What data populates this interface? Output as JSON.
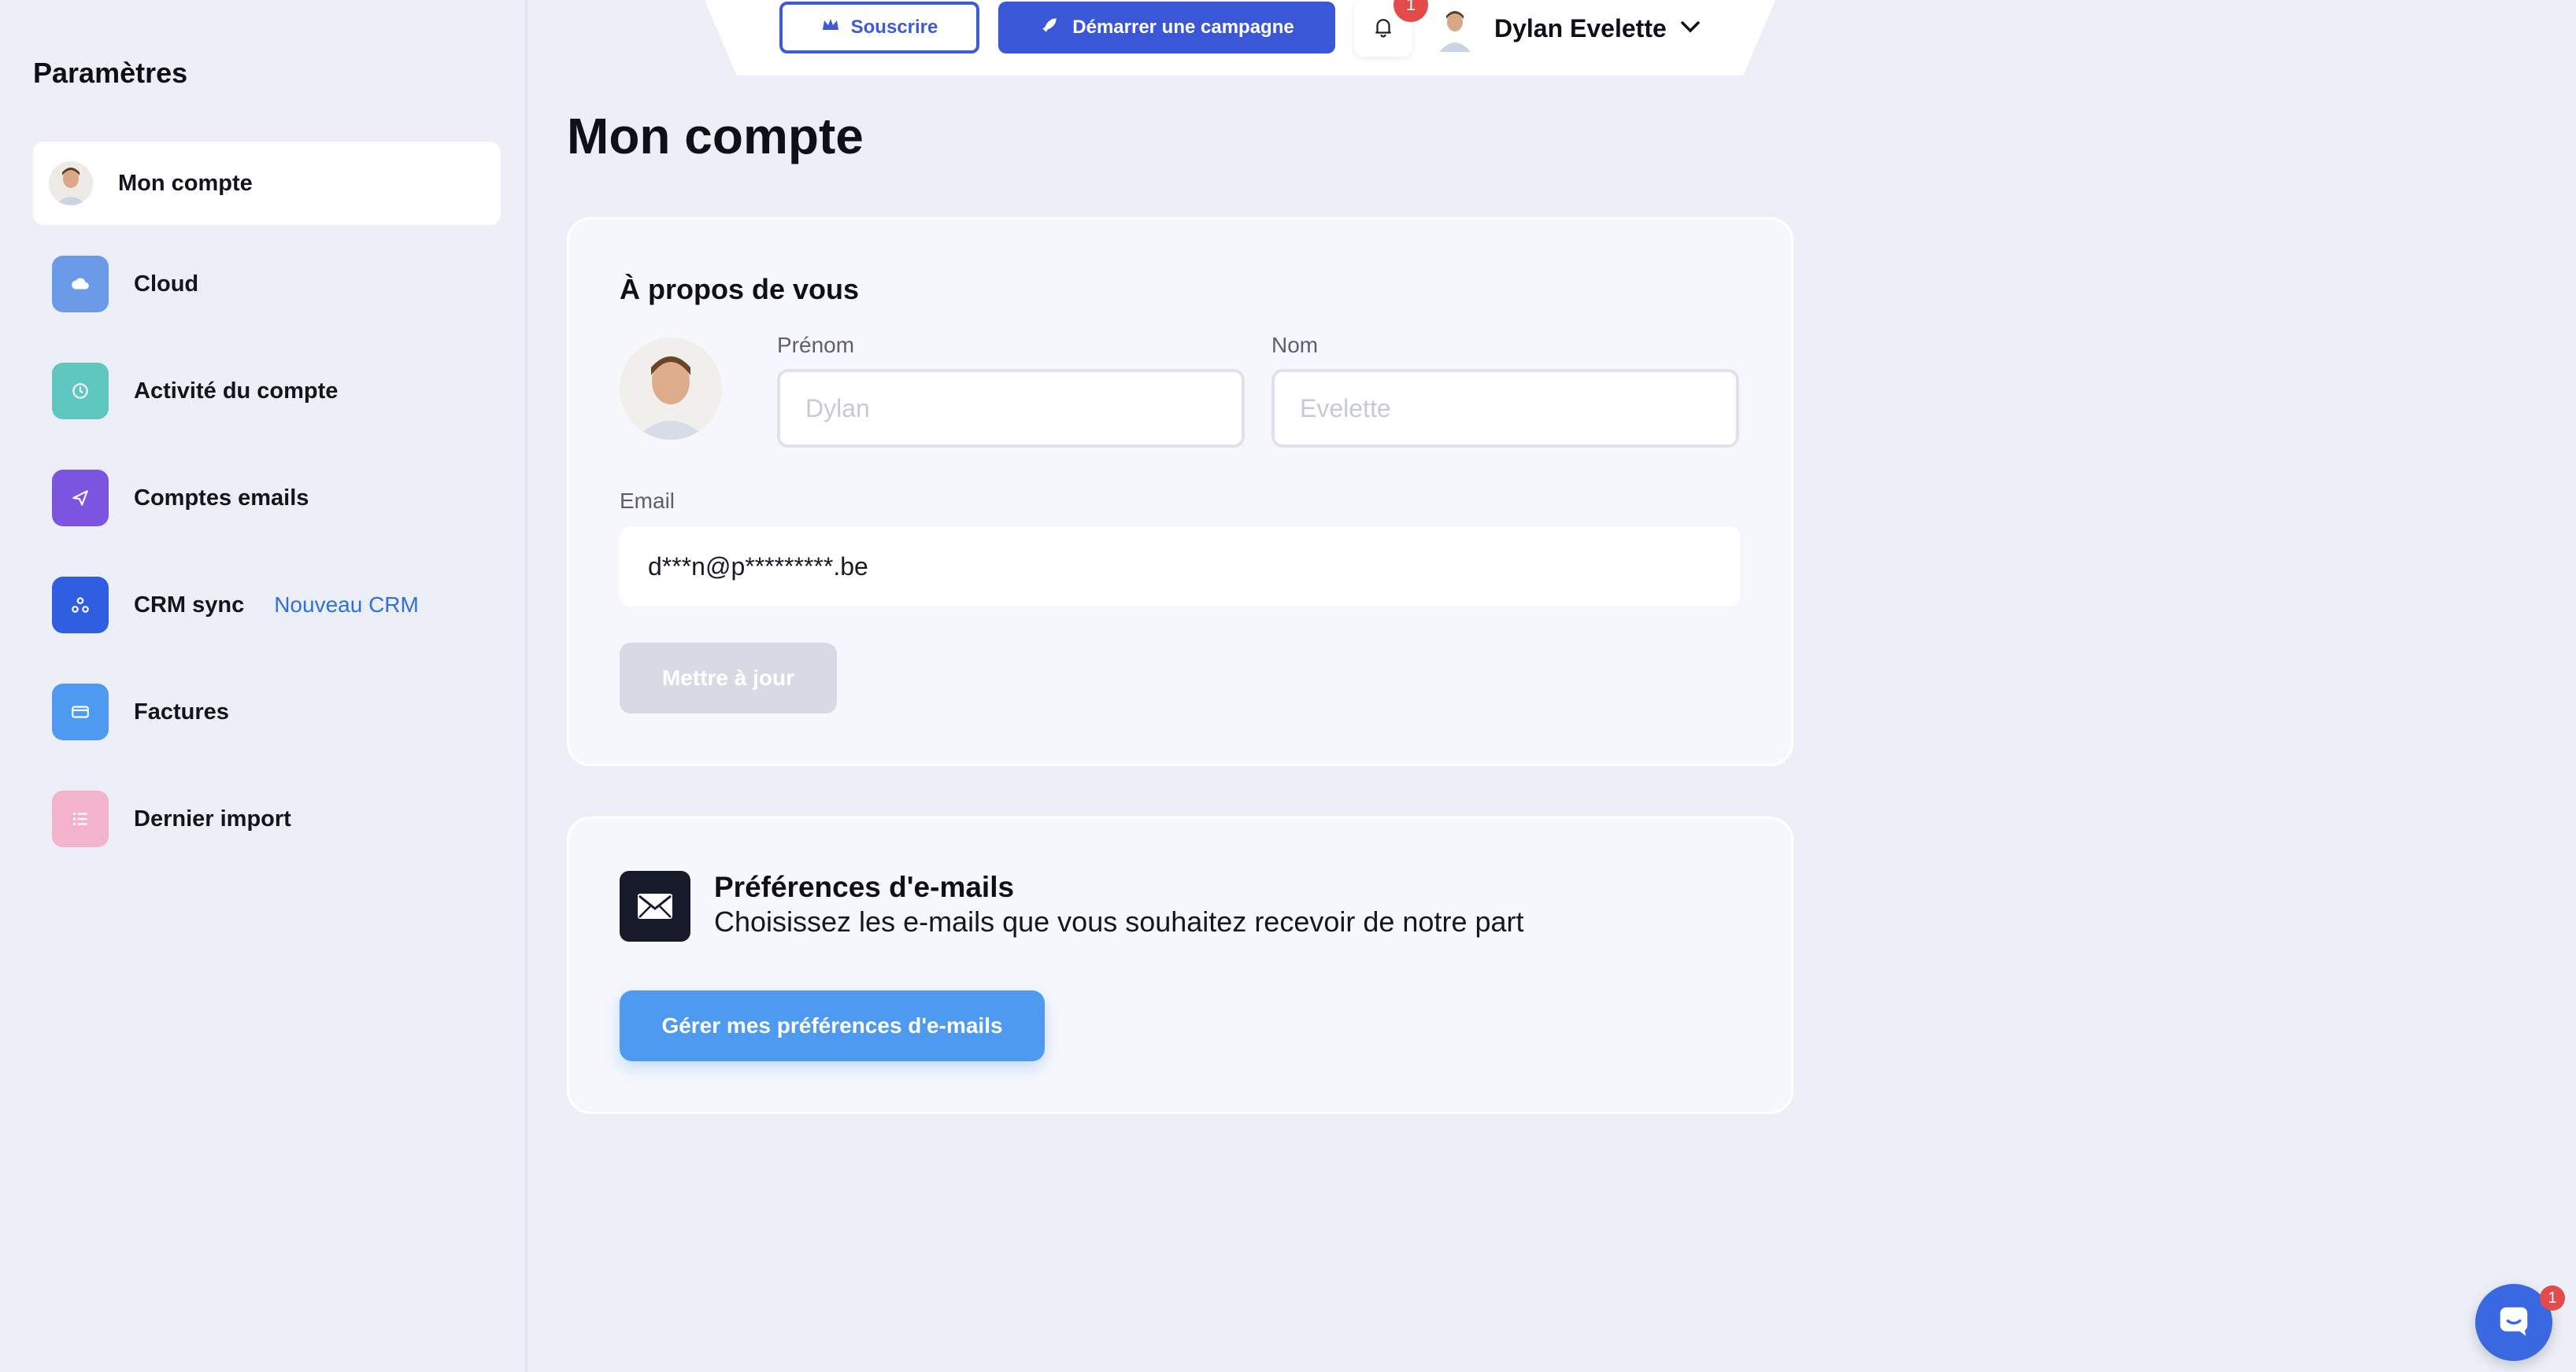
{
  "sidebar": {
    "title": "Paramètres",
    "items": [
      {
        "label": "Mon compte",
        "icon": "avatar-photo",
        "active": true
      },
      {
        "label": "Cloud",
        "icon": "cloud-icon",
        "color": "#6b9ae8"
      },
      {
        "label": "Activité du compte",
        "icon": "clock-icon",
        "color": "#5fc6c0"
      },
      {
        "label": "Comptes emails",
        "icon": "send-icon",
        "color": "#7b55e0"
      },
      {
        "label": "CRM sync",
        "icon": "webhook-icon",
        "color": "#2f5fe0",
        "badge": "Nouveau CRM"
      },
      {
        "label": "Factures",
        "icon": "card-icon",
        "color": "#4d9af0"
      },
      {
        "label": "Dernier import",
        "icon": "list-icon",
        "color": "#f2b3cb"
      }
    ]
  },
  "topbar": {
    "subscribe_label": "Souscrire",
    "campaign_label": "Démarrer une campagne",
    "notification_count": "1",
    "user_name": "Dylan Evelette"
  },
  "page": {
    "title": "Mon compte"
  },
  "about": {
    "title": "À propos de vous",
    "first_name_label": "Prénom",
    "first_name_placeholder": "Dylan",
    "last_name_label": "Nom",
    "last_name_placeholder": "Evelette",
    "email_label": "Email",
    "email_value": "d***n@p*********.be",
    "update_label": "Mettre à jour"
  },
  "email_prefs": {
    "title": "Préférences d'e-mails",
    "subtitle": "Choisissez les e-mails que vous souhaitez recevoir de notre part",
    "button_label": "Gérer mes préférences d'e-mails"
  },
  "chat": {
    "badge_count": "1"
  },
  "colors": {
    "primary": "#3a57d8",
    "accent_blue": "#4d9af0",
    "background": "#eceff8",
    "badge_red": "#e34b4b"
  }
}
